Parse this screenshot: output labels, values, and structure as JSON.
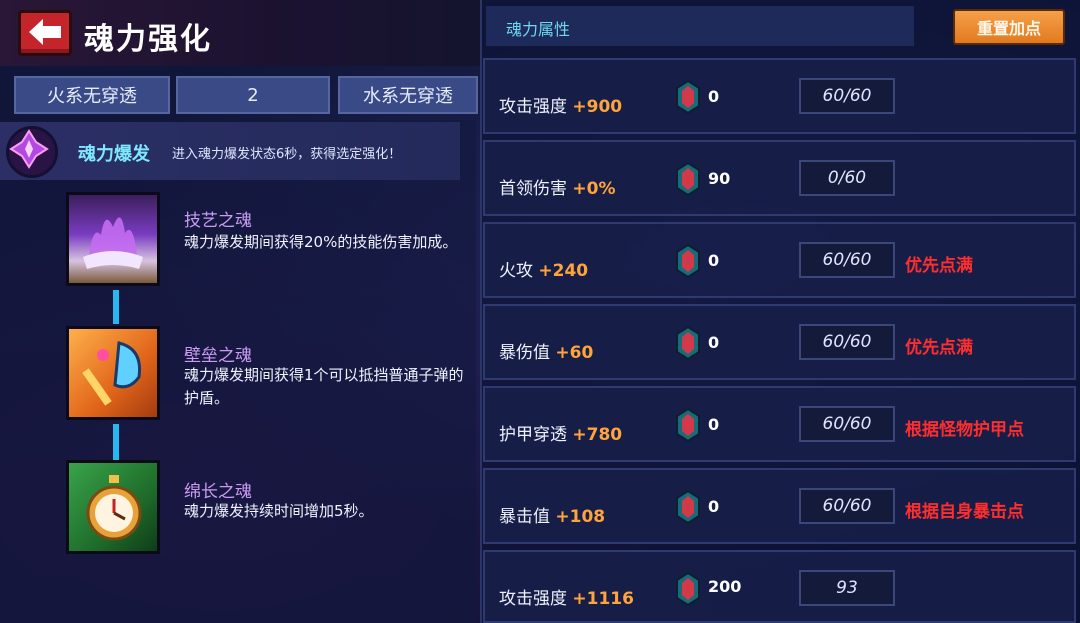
{
  "header": {
    "title": "魂力强化"
  },
  "tabs": [
    {
      "label": "火系无穿透"
    },
    {
      "label": "2"
    },
    {
      "label": "水系无穿透"
    }
  ],
  "burst": {
    "title": "魂力爆发",
    "description": "进入魂力爆发状态6秒，获得选定强化！"
  },
  "skills": [
    {
      "name": "技艺之魂",
      "description": "魂力爆发期间获得20%的技能伤害加成。",
      "icon": "purple-flame-skill-icon"
    },
    {
      "name": "壁垒之魂",
      "description": "魂力爆发期间获得1个可以抵挡普通子弹的护盾。",
      "icon": "shield-axe-skill-icon"
    },
    {
      "name": "绵长之魂",
      "description": "魂力爆发持续时间增加5秒。",
      "icon": "stopwatch-skill-icon"
    }
  ],
  "attributes": {
    "header_label": "魂力属性",
    "reset_label": "重置加点",
    "rows": [
      {
        "name": "攻击强度",
        "bonus": "+900",
        "gems": "0",
        "level": "60/60",
        "note": ""
      },
      {
        "name": "首领伤害",
        "bonus": "+0%",
        "gems": "90",
        "level": "0/60",
        "note": ""
      },
      {
        "name": "火攻",
        "bonus": "+240",
        "gems": "0",
        "level": "60/60",
        "note": "优先点满"
      },
      {
        "name": "暴伤值",
        "bonus": "+60",
        "gems": "0",
        "level": "60/60",
        "note": "优先点满"
      },
      {
        "name": "护甲穿透",
        "bonus": "+780",
        "gems": "0",
        "level": "60/60",
        "note": "根据怪物护甲点"
      },
      {
        "name": "暴击值",
        "bonus": "+108",
        "gems": "0",
        "level": "60/60",
        "note": "根据自身暴击点"
      },
      {
        "name": "攻击强度",
        "bonus": "+1116",
        "gems": "200",
        "level": "93",
        "note": ""
      }
    ]
  },
  "colors": {
    "accent_cyan": "#6fd9f0",
    "bonus_orange": "#ffa43b",
    "note_red": "#ff2e2e",
    "reset_orange": "#e27a1e",
    "back_red": "#c4242a"
  }
}
